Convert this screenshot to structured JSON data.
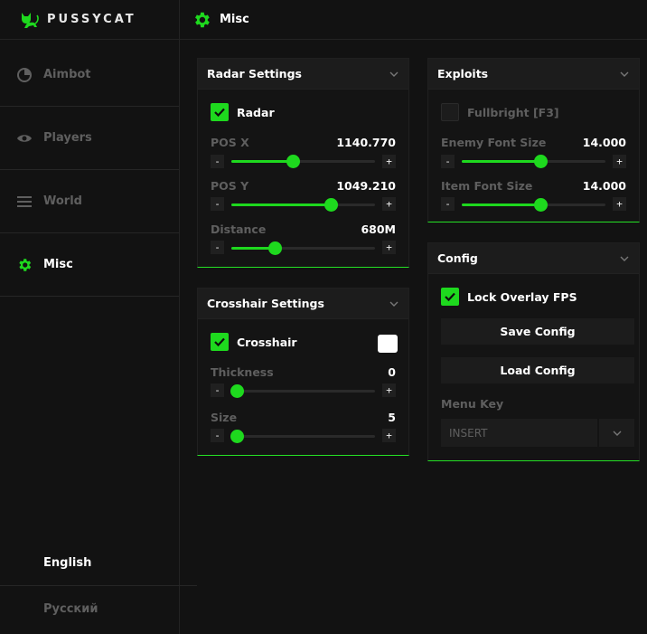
{
  "brand": {
    "name": "PUSSYCAT",
    "accent": "#1ed91e"
  },
  "sidebar": {
    "items": [
      {
        "label": "Aimbot",
        "icon": "target-icon",
        "active": false
      },
      {
        "label": "Players",
        "icon": "eye-icon",
        "active": false
      },
      {
        "label": "World",
        "icon": "menu-lines-icon",
        "active": false
      },
      {
        "label": "Misc",
        "icon": "gear-icon",
        "active": true
      }
    ],
    "languages": [
      "English",
      "Русский"
    ],
    "selected_language": "English"
  },
  "header": {
    "title": "Misc",
    "icon": "gear-icon"
  },
  "radar": {
    "title": "Radar Settings",
    "toggle_label": "Radar",
    "toggle_checked": true,
    "sliders": [
      {
        "label": "POS X",
        "value": "1140.770",
        "fraction": 0.43
      },
      {
        "label": "POS Y",
        "value": "1049.210",
        "fraction": 0.69
      },
      {
        "label": "Distance",
        "value": "680M",
        "fraction": 0.3
      }
    ]
  },
  "crosshair": {
    "title": "Crosshair Settings",
    "toggle_label": "Crosshair",
    "toggle_checked": true,
    "color": "#ffffff",
    "sliders": [
      {
        "label": "Thickness",
        "value": "0",
        "fraction": 0.04
      },
      {
        "label": "Size",
        "value": "5",
        "fraction": 0.04
      }
    ]
  },
  "exploits": {
    "title": "Exploits",
    "toggle_label": "Fullbright [F3]",
    "toggle_checked": false,
    "sliders": [
      {
        "label": "Enemy Font Size",
        "value": "14.000",
        "fraction": 0.55
      },
      {
        "label": "Item Font Size",
        "value": "14.000",
        "fraction": 0.55
      }
    ]
  },
  "config": {
    "title": "Config",
    "toggle_label": "Lock Overlay FPS",
    "toggle_checked": true,
    "save_label": "Save Config",
    "load_label": "Load Config",
    "menu_key_label": "Menu Key",
    "menu_key_value": "INSERT"
  },
  "stepper": {
    "minus": "-",
    "plus": "+"
  }
}
